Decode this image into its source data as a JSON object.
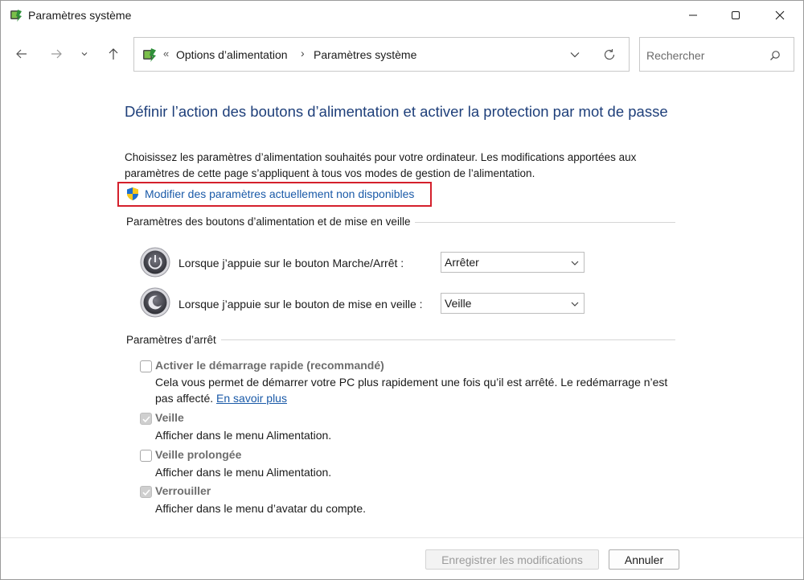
{
  "window": {
    "title": "Paramètres système",
    "controls": {
      "minimize": "minimize",
      "maximize": "maximize",
      "close": "close"
    }
  },
  "address": {
    "breadcrumb": [
      "Options d’alimentation",
      "Paramètres système"
    ],
    "overflow_glyph": "«",
    "separator": "›"
  },
  "search": {
    "placeholder": "Rechercher"
  },
  "page": {
    "heading": "Définir l’action des boutons d’alimentation et activer la protection par mot de passe",
    "description": "Choisissez les paramètres d’alimentation souhaités pour votre ordinateur. Les modifications apportées aux paramètres de cette page s’appliquent à tous vos modes de gestion de l’alimentation.",
    "admin_link": "Modifier des paramètres actuellement non disponibles"
  },
  "buttons_section": {
    "title": "Paramètres des boutons d’alimentation et de mise en veille",
    "rows": [
      {
        "label": "Lorsque j’appuie sur le bouton Marche/Arrêt :",
        "value": "Arrêter",
        "icon": "power-button-icon"
      },
      {
        "label": "Lorsque j’appuie sur le bouton de mise en veille :",
        "value": "Veille",
        "icon": "sleep-button-icon"
      }
    ]
  },
  "shutdown_section": {
    "title": "Paramètres d’arrêt",
    "options": [
      {
        "title": "Activer le démarrage rapide (recommandé)",
        "checked": false,
        "desc": "Cela vous permet de démarrer votre PC plus rapidement une fois qu’il est arrêté. Le redémarrage n’est pas affecté.",
        "link": "En savoir plus"
      },
      {
        "title": "Veille",
        "checked": true,
        "desc": "Afficher dans le menu Alimentation."
      },
      {
        "title": "Veille prolongée",
        "checked": false,
        "desc": "Afficher dans le menu Alimentation."
      },
      {
        "title": "Verrouiller",
        "checked": true,
        "desc": "Afficher dans le menu d’avatar du compte."
      }
    ]
  },
  "footer": {
    "save": "Enregistrer les modifications",
    "cancel": "Annuler"
  },
  "colors": {
    "heading": "#1e3f7a",
    "link": "#1a5aa8",
    "highlight": "#d4202c",
    "disabled_text": "#6d6d6d"
  }
}
